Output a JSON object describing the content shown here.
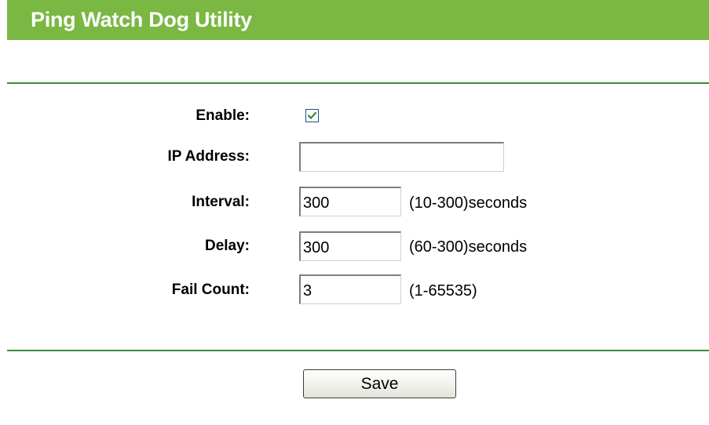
{
  "header": {
    "title": "Ping Watch Dog Utility"
  },
  "form": {
    "enable": {
      "label": "Enable:",
      "checked": true
    },
    "ip_address": {
      "label": "IP Address:",
      "value": ""
    },
    "interval": {
      "label": "Interval:",
      "value": "300",
      "hint": "(10-300)seconds"
    },
    "delay": {
      "label": "Delay:",
      "value": "300",
      "hint": "(60-300)seconds"
    },
    "fail_count": {
      "label": "Fail Count:",
      "value": "3",
      "hint": "(1-65535)"
    }
  },
  "actions": {
    "save_label": "Save"
  },
  "colors": {
    "title_bar": "#7ab743",
    "divider": "#3a8a3a",
    "checkmark": "#2e8b2e"
  },
  "icons": {
    "checkbox_mark": "checkmark-icon"
  }
}
